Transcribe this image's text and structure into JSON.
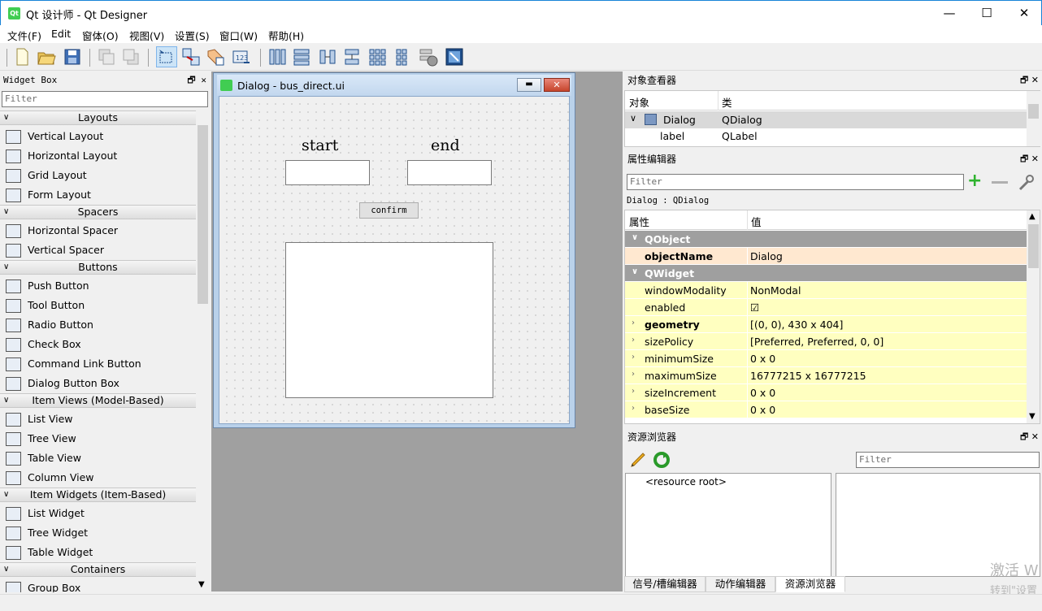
{
  "window": {
    "title": "Qt 设计师 - Qt Designer",
    "qt_badge": "Qt",
    "minimize": "—",
    "maximize": "☐",
    "close": "✕"
  },
  "menu": [
    "文件(F)",
    "Edit",
    "窗体(O)",
    "视图(V)",
    "设置(S)",
    "窗口(W)",
    "帮助(H)"
  ],
  "toolbar": {
    "icons": [
      "new-file-icon",
      "open-folder-icon",
      "save-icon",
      "send-to-back-icon",
      "bring-to-front-icon",
      "edit-widgets-icon",
      "edit-signals-slots-icon",
      "edit-buddies-icon",
      "edit-tab-order-icon",
      "layout-horizontal-icon",
      "layout-vertical-icon",
      "layout-h-splitter-icon",
      "layout-v-splitter-icon",
      "layout-grid-icon",
      "layout-form-icon",
      "break-layout-icon",
      "adjust-size-icon"
    ]
  },
  "widget_box": {
    "title": "Widget Box",
    "filter_placeholder": "Filter",
    "categories": [
      {
        "label": "Layouts",
        "items": [
          "Vertical Layout",
          "Horizontal Layout",
          "Grid Layout",
          "Form Layout"
        ]
      },
      {
        "label": "Spacers",
        "items": [
          "Horizontal Spacer",
          "Vertical Spacer"
        ]
      },
      {
        "label": "Buttons",
        "items": [
          "Push Button",
          "Tool Button",
          "Radio Button",
          "Check Box",
          "Command Link Button",
          "Dialog Button Box"
        ]
      },
      {
        "label": "Item Views (Model-Based)",
        "items": [
          "List View",
          "Tree View",
          "Table View",
          "Column View"
        ]
      },
      {
        "label": "Item Widgets (Item-Based)",
        "items": [
          "List Widget",
          "Tree Widget",
          "Table Widget"
        ]
      },
      {
        "label": "Containers",
        "items": [
          "Group Box"
        ]
      }
    ]
  },
  "dialog": {
    "title": "Dialog - bus_direct.ui",
    "label_start": "start",
    "label_end": "end",
    "confirm": "confirm"
  },
  "object_inspector": {
    "title": "对象查看器",
    "col_object": "对象",
    "col_class": "类",
    "rows": [
      {
        "object": "Dialog",
        "class": "QDialog"
      },
      {
        "object": "label",
        "class": "QLabel"
      }
    ]
  },
  "property_editor": {
    "title": "属性编辑器",
    "filter_placeholder": "Filter",
    "context": "Dialog : QDialog",
    "col_prop": "属性",
    "col_value": "值",
    "rows": [
      {
        "name": "QObject",
        "value": "",
        "kind": "group"
      },
      {
        "name": "objectName",
        "value": "Dialog",
        "kind": "bold-org"
      },
      {
        "name": "QWidget",
        "value": "",
        "kind": "group"
      },
      {
        "name": "windowModality",
        "value": "NonModal",
        "kind": "plain"
      },
      {
        "name": "enabled",
        "value": "☑",
        "kind": "plain"
      },
      {
        "name": "geometry",
        "value": "[(0, 0), 430 x 404]",
        "kind": "bold-exp"
      },
      {
        "name": "sizePolicy",
        "value": "[Preferred, Preferred, 0, 0]",
        "kind": "exp"
      },
      {
        "name": "minimumSize",
        "value": "0 x 0",
        "kind": "exp"
      },
      {
        "name": "maximumSize",
        "value": "16777215 x 16777215",
        "kind": "exp"
      },
      {
        "name": "sizeIncrement",
        "value": "0 x 0",
        "kind": "exp"
      },
      {
        "name": "baseSize",
        "value": "0 x 0",
        "kind": "exp"
      }
    ]
  },
  "resource_browser": {
    "title": "资源浏览器",
    "filter_placeholder": "Filter",
    "root": "<resource root>",
    "tabs": [
      "信号/槽编辑器",
      "动作编辑器",
      "资源浏览器"
    ]
  },
  "watermark": {
    "line1": "激活 W",
    "line2": "转到\"设置"
  }
}
